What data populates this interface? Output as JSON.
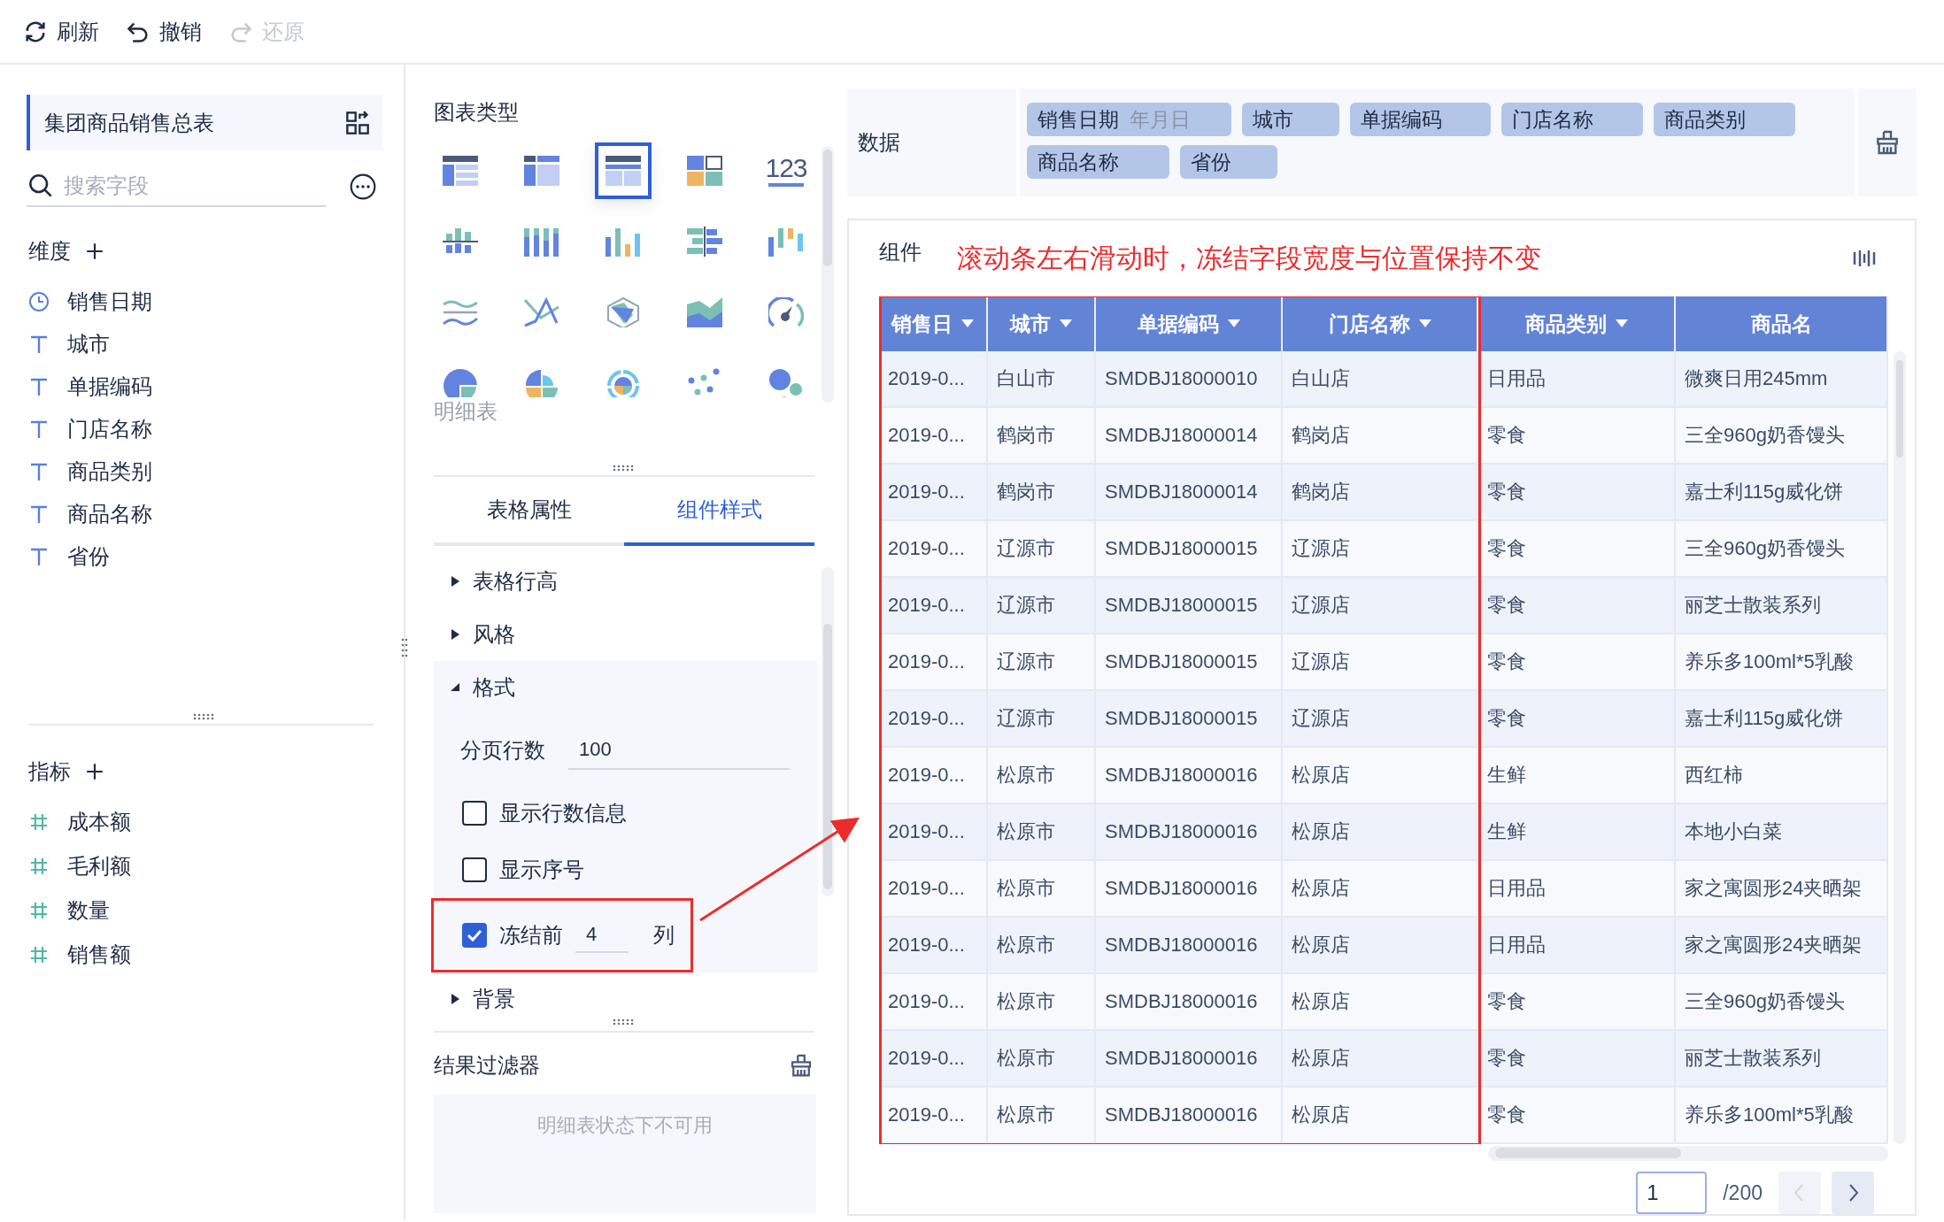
{
  "toolbar": [
    {
      "label": "刷新",
      "kind": "refresh",
      "disabled": false
    },
    {
      "label": "撤销",
      "kind": "undo",
      "disabled": false
    },
    {
      "label": "还原",
      "kind": "redo",
      "disabled": true
    }
  ],
  "table_name": "集团商品销售总表",
  "search": {
    "placeholder": "搜索字段"
  },
  "dimensions": {
    "title": "维度",
    "items": [
      {
        "label": "销售日期",
        "kind": "date"
      },
      {
        "label": "城市",
        "kind": "text"
      },
      {
        "label": "单据编码",
        "kind": "text"
      },
      {
        "label": "门店名称",
        "kind": "text"
      },
      {
        "label": "商品类别",
        "kind": "text"
      },
      {
        "label": "商品名称",
        "kind": "text"
      },
      {
        "label": "省份",
        "kind": "text"
      }
    ]
  },
  "metrics": {
    "title": "指标",
    "items": [
      {
        "label": "成本额",
        "kind": "number"
      },
      {
        "label": "毛利额",
        "kind": "number"
      },
      {
        "label": "数量",
        "kind": "number"
      },
      {
        "label": "销售额",
        "kind": "number"
      }
    ]
  },
  "chart_types": {
    "title": "图表类型",
    "hint": "明细表",
    "items": [
      {
        "kind": "group_table",
        "selected": false
      },
      {
        "kind": "cross_table",
        "selected": false
      },
      {
        "kind": "detail_table",
        "selected": true
      },
      {
        "kind": "kpi_grid",
        "selected": false
      },
      {
        "kind": "number",
        "glyph": "123",
        "selected": false
      },
      {
        "kind": "diverging_bar",
        "selected": false
      },
      {
        "kind": "stacked_column",
        "selected": false
      },
      {
        "kind": "column",
        "selected": false
      },
      {
        "kind": "bidirectional_bar",
        "selected": false
      },
      {
        "kind": "waterfall",
        "selected": false
      },
      {
        "kind": "range_line",
        "selected": false
      },
      {
        "kind": "line",
        "selected": false
      },
      {
        "kind": "radar",
        "selected": false
      },
      {
        "kind": "area",
        "selected": false
      },
      {
        "kind": "gauge",
        "selected": false
      },
      {
        "kind": "pie",
        "selected": false
      },
      {
        "kind": "rose",
        "selected": false
      },
      {
        "kind": "sunburst",
        "selected": false
      },
      {
        "kind": "scatter",
        "selected": false
      },
      {
        "kind": "bubble",
        "selected": false
      }
    ]
  },
  "tabs": [
    {
      "label": "表格属性",
      "selected": false
    },
    {
      "label": "组件样式",
      "selected": true
    }
  ],
  "style_sections": [
    {
      "label": "表格行高",
      "expanded": false
    },
    {
      "label": "风格",
      "expanded": false
    },
    {
      "label": "格式",
      "expanded": true
    },
    {
      "label": "背景",
      "expanded": false
    }
  ],
  "format": {
    "page_rows_label": "分页行数",
    "page_rows": "100",
    "options": [
      {
        "label": "显示行数信息",
        "checked": false
      },
      {
        "label": "显示序号",
        "checked": false
      }
    ],
    "freeze": {
      "checked": true,
      "prefix": "冻结前",
      "value": "4",
      "suffix": "列"
    }
  },
  "result_filter": {
    "title": "结果过滤器",
    "message": "明细表状态下不可用"
  },
  "data": {
    "label": "数据",
    "fields": [
      {
        "label": "销售日期",
        "granularity": "年月日"
      },
      {
        "label": "城市"
      },
      {
        "label": "单据编码"
      },
      {
        "label": "门店名称"
      },
      {
        "label": "商品类别"
      },
      {
        "label": "商品名称"
      },
      {
        "label": "省份"
      }
    ]
  },
  "component": {
    "label": "组件",
    "annotation": "滚动条左右滑动时，冻结字段宽度与位置保持不变",
    "table": {
      "columns": [
        {
          "label": "销售日",
          "sortable": true
        },
        {
          "label": "城市",
          "sortable": true
        },
        {
          "label": "单据编码",
          "sortable": true
        },
        {
          "label": "门店名称",
          "sortable": true
        },
        {
          "label": "商品类别",
          "sortable": true
        },
        {
          "label": "商品名",
          "sortable": false
        }
      ],
      "rows": [
        [
          "2019-0...",
          "白山市",
          "SMDBJ18000010",
          "白山店",
          "日用品",
          "微爽日用245mm"
        ],
        [
          "2019-0...",
          "鹤岗市",
          "SMDBJ18000014",
          "鹤岗店",
          "零食",
          "三全960g奶香馒头"
        ],
        [
          "2019-0...",
          "鹤岗市",
          "SMDBJ18000014",
          "鹤岗店",
          "零食",
          "嘉士利115g威化饼"
        ],
        [
          "2019-0...",
          "辽源市",
          "SMDBJ18000015",
          "辽源店",
          "零食",
          "三全960g奶香馒头"
        ],
        [
          "2019-0...",
          "辽源市",
          "SMDBJ18000015",
          "辽源店",
          "零食",
          "丽芝士散装系列"
        ],
        [
          "2019-0...",
          "辽源市",
          "SMDBJ18000015",
          "辽源店",
          "零食",
          "养乐多100ml*5乳酸"
        ],
        [
          "2019-0...",
          "辽源市",
          "SMDBJ18000015",
          "辽源店",
          "零食",
          "嘉士利115g威化饼"
        ],
        [
          "2019-0...",
          "松原市",
          "SMDBJ18000016",
          "松原店",
          "生鲜",
          "西红柿"
        ],
        [
          "2019-0...",
          "松原市",
          "SMDBJ18000016",
          "松原店",
          "生鲜",
          "本地小白菜"
        ],
        [
          "2019-0...",
          "松原市",
          "SMDBJ18000016",
          "松原店",
          "日用品",
          "家之寓圆形24夹晒架"
        ],
        [
          "2019-0...",
          "松原市",
          "SMDBJ18000016",
          "松原店",
          "日用品",
          "家之寓圆形24夹晒架"
        ],
        [
          "2019-0...",
          "松原市",
          "SMDBJ18000016",
          "松原店",
          "零食",
          "三全960g奶香馒头"
        ],
        [
          "2019-0...",
          "松原市",
          "SMDBJ18000016",
          "松原店",
          "零食",
          "丽芝士散装系列"
        ],
        [
          "2019-0...",
          "松原市",
          "SMDBJ18000016",
          "松原店",
          "零食",
          "养乐多100ml*5乳酸"
        ]
      ]
    }
  },
  "pagination": {
    "page": "1",
    "total": "/200",
    "buttons": [
      {
        "kind": "prev",
        "disabled": true
      },
      {
        "kind": "next",
        "disabled": false
      }
    ]
  }
}
